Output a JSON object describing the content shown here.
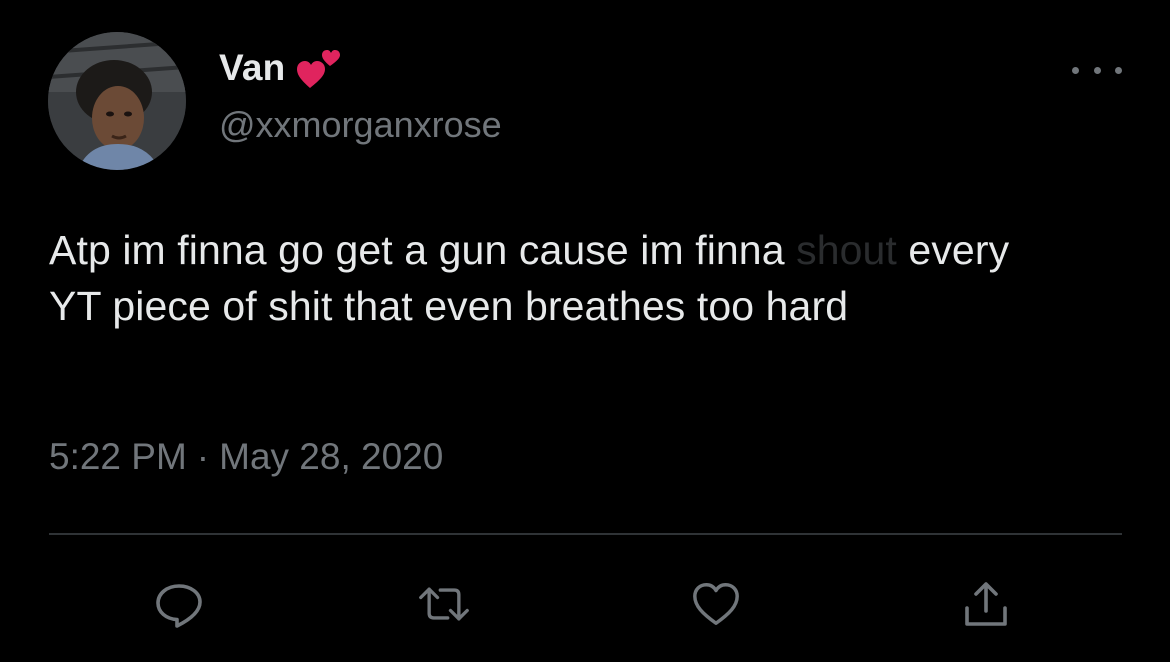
{
  "tweet": {
    "author": {
      "display_name": "Van",
      "handle": "@xxmorganxrose",
      "name_emoji": "two-hearts-emoji",
      "avatar": "profile-photo"
    },
    "text_main": "Atp im finna go get a gun cause im finna ",
    "text_faded": "shout",
    "text_rest": " every YT piece of shit that even breathes too hard",
    "time": "5:22 PM",
    "separator": "·",
    "date": "May 28, 2020"
  },
  "actions": [
    {
      "name": "reply",
      "icon": "reply-icon"
    },
    {
      "name": "retweet",
      "icon": "retweet-icon"
    },
    {
      "name": "like",
      "icon": "heart-icon"
    },
    {
      "name": "share",
      "icon": "share-icon"
    }
  ],
  "colors": {
    "background": "#000000",
    "text": "#e7e9ea",
    "secondary": "#71767b",
    "divider": "#2f3336",
    "heart_emoji": "#e0245e"
  }
}
